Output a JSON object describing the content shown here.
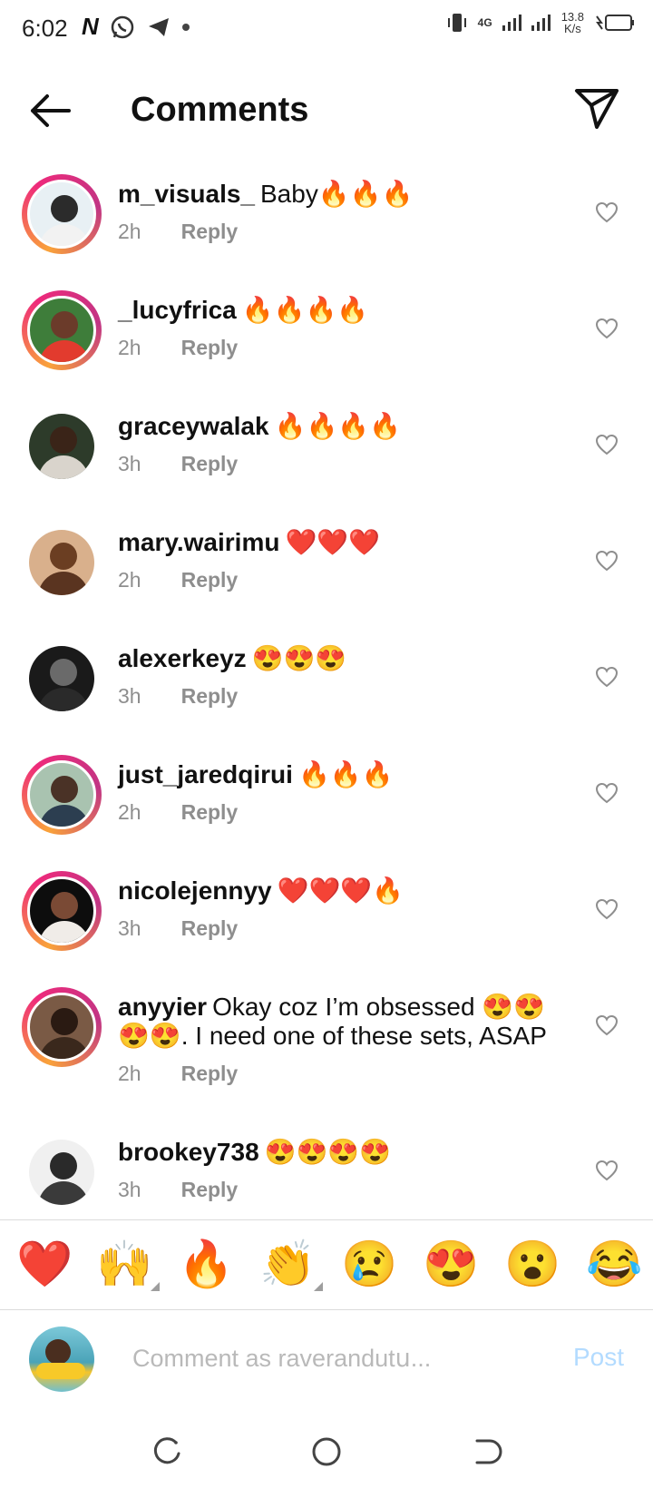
{
  "status_bar": {
    "time": "6:02",
    "network": "4G",
    "speed_value": "13.8",
    "speed_unit": "K/s"
  },
  "header": {
    "title": "Comments"
  },
  "comments": [
    {
      "username": "m_visuals_",
      "text": "Baby🔥🔥🔥",
      "time": "2h",
      "reply": "Reply",
      "story_ring": true,
      "avatar_colors": [
        "#e8f0f4",
        "#2b2b2b",
        "#f2f2f2"
      ]
    },
    {
      "username": "_lucyfrica",
      "text": "🔥🔥🔥🔥",
      "time": "2h",
      "reply": "Reply",
      "story_ring": true,
      "avatar_colors": [
        "#3e7d3a",
        "#6b3b2a",
        "#e23b2e"
      ]
    },
    {
      "username": "graceywalak",
      "text": "🔥🔥🔥🔥",
      "time": "3h",
      "reply": "Reply",
      "story_ring": false,
      "avatar_colors": [
        "#2d3b2a",
        "#3a2418",
        "#d9d4cc"
      ]
    },
    {
      "username": "mary.wairimu",
      "text": "❤️❤️❤️",
      "time": "2h",
      "reply": "Reply",
      "story_ring": false,
      "avatar_colors": [
        "#d9b08c",
        "#6b3e22",
        "#5a3420"
      ]
    },
    {
      "username": "alexerkeyz",
      "text": "😍😍😍",
      "time": "3h",
      "reply": "Reply",
      "story_ring": false,
      "avatar_colors": [
        "#1a1a1a",
        "#6a6a6a",
        "#2a2a2a"
      ]
    },
    {
      "username": "just_jaredqirui",
      "text": "🔥🔥🔥",
      "time": "2h",
      "reply": "Reply",
      "story_ring": true,
      "avatar_colors": [
        "#a9c3b0",
        "#4a3226",
        "#2c3e50"
      ]
    },
    {
      "username": "nicolejennyy",
      "text": "❤️❤️❤️🔥",
      "time": "3h",
      "reply": "Reply",
      "story_ring": true,
      "avatar_colors": [
        "#0d0d0d",
        "#7a4a35",
        "#f0ece8"
      ]
    },
    {
      "username": "anyyier",
      "text": "Okay coz I’m obsessed 😍😍😍😍. I need one of these sets, ASAP",
      "time": "2h",
      "reply": "Reply",
      "story_ring": true,
      "avatar_colors": [
        "#7a5a45",
        "#2a1a12",
        "#3a281c"
      ]
    },
    {
      "username": "brookey738",
      "text": "😍😍😍😍",
      "time": "3h",
      "reply": "Reply",
      "story_ring": false,
      "avatar_colors": [
        "#f0f0f0",
        "#2a2a2a",
        "#3a3a3a"
      ]
    }
  ],
  "reaction_bar": {
    "emojis": [
      "❤️",
      "🙌",
      "🔥",
      "👏",
      "😢",
      "😍",
      "😮",
      "😂"
    ]
  },
  "composer": {
    "placeholder": "Comment as raverandutս...",
    "post_label": "Post"
  },
  "colors": {
    "ring_gradient": [
      "#f9a23a",
      "#ee2a7b",
      "#c13584"
    ],
    "secondary_text": "#8e8e8e",
    "post_disabled": "#b3dbff"
  }
}
